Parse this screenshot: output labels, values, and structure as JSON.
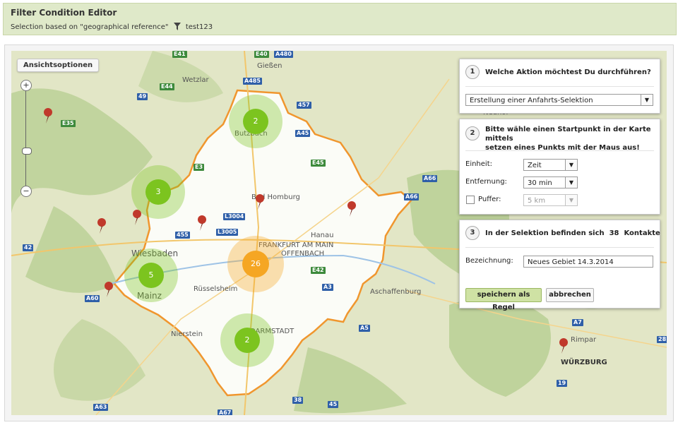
{
  "header": {
    "title": "Filter Condition Editor",
    "subtitle_prefix": "Selection based on \"geographical reference\"",
    "filter_name": "test123"
  },
  "map": {
    "view_options_label": "Ansichtsoptionen",
    "zoom_in": "+",
    "zoom_out": "−",
    "clusters": [
      {
        "count": "2",
        "color": "green"
      },
      {
        "count": "3",
        "color": "green"
      },
      {
        "count": "5",
        "color": "green"
      },
      {
        "count": "26",
        "color": "orange"
      },
      {
        "count": "2",
        "color": "green"
      }
    ],
    "places": [
      "Gießen",
      "Wetzlar",
      "Butzbach",
      "Bad Homburg",
      "Hanau",
      "FRANKFURT AM MAIN",
      "OFFENBACH",
      "Wiesbaden",
      "Mainz",
      "Rüsselsheim",
      "DARMSTADT",
      "Nierstein",
      "Aschaffenburg",
      "Rimpar",
      "WÜRZBURG",
      "Neuhof"
    ],
    "roads": [
      "E41",
      "E40",
      "A480",
      "A485",
      "E44",
      "49",
      "457",
      "E35",
      "A45",
      "A66",
      "A66",
      "L3004",
      "L3005",
      "42",
      "455",
      "A60",
      "A3",
      "A63",
      "A67",
      "E42",
      "38",
      "45",
      "A5",
      "A7",
      "19",
      "28",
      "E45",
      "E3"
    ],
    "colors": {
      "isochrone_fill": "#ffffff",
      "isochrone_border": "#f0962e",
      "cluster_green": "#7cc41f",
      "cluster_orange": "#f5a623",
      "pin": "#c0392b"
    }
  },
  "panel1": {
    "step": "1",
    "title": "Welche Aktion möchtest Du durchführen?",
    "action_value": "Erstellung einer Anfahrts-Selektion"
  },
  "panel2": {
    "step": "2",
    "title_line1": "Bitte wähle einen Startpunkt in der Karte mittels",
    "title_line2": "setzen eines Punkts mit der Maus aus!",
    "unit_label": "Einheit:",
    "unit_value": "Zeit",
    "distance_label": "Entfernung:",
    "distance_value": "30 min",
    "buffer_label": "Puffer:",
    "buffer_value": "5 km"
  },
  "panel3": {
    "step": "3",
    "title": "In der Selektion befinden sich  38  Kontakte",
    "name_label": "Bezeichnung:",
    "name_value": "Neues Gebiet 14.3.2014",
    "save_label": "speichern als Regel",
    "cancel_label": "abbrechen"
  }
}
